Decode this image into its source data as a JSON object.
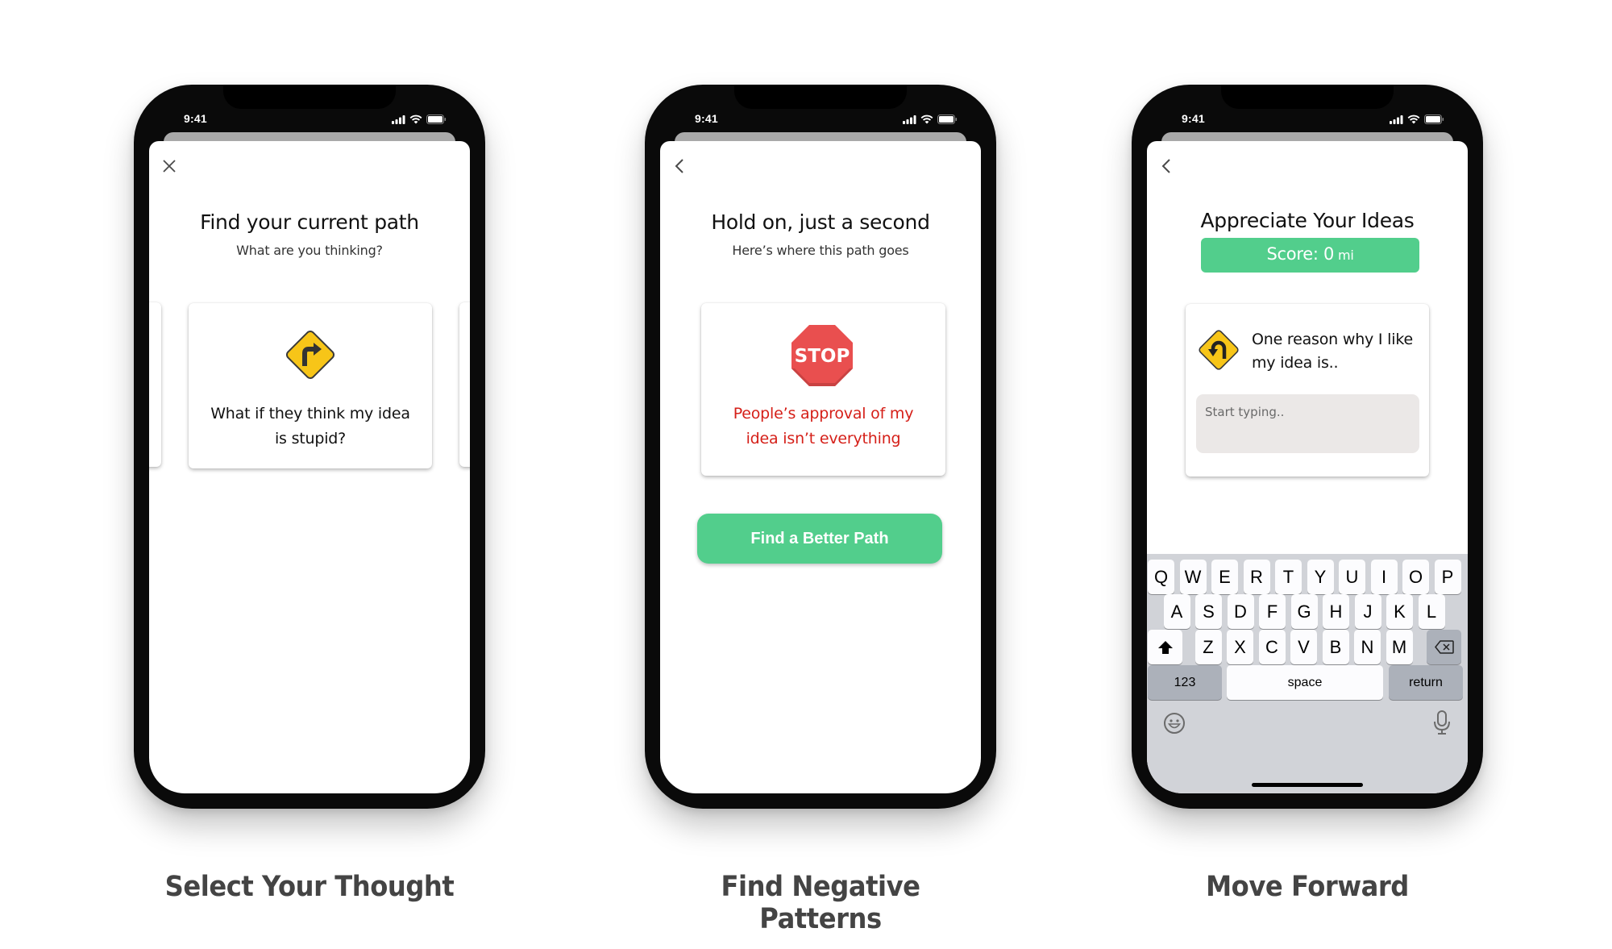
{
  "colors": {
    "accent_green": "#52ce8c",
    "sign_yellow": "#f7c518",
    "stop_red": "#e94f4f",
    "warning_text_red": "#d51f18"
  },
  "phones": [
    {
      "status_time": "9:41",
      "nav_icon": "close-icon",
      "title": "Find your current path",
      "subtitle": "What are you thinking?",
      "card": {
        "icon": "right-turn-sign-icon",
        "text": "What if they think my idea is stupid?"
      },
      "caption": "Select Your Thought"
    },
    {
      "status_time": "9:41",
      "nav_icon": "back-chevron-icon",
      "title": "Hold on, just a second",
      "subtitle": "Here’s where this path goes",
      "card": {
        "icon": "stop-sign-icon",
        "icon_text": "STOP",
        "text": "People’s approval of my idea isn’t everything"
      },
      "button_label": "Find a Better Path",
      "caption": "Find Negative Patterns"
    },
    {
      "status_time": "9:41",
      "nav_icon": "back-chevron-icon",
      "title": "Appreciate Your Ideas",
      "score": {
        "label": "Score: 0",
        "unit": "mi"
      },
      "card": {
        "icon": "u-turn-sign-icon",
        "text": "One reason why I like my idea is..",
        "input_placeholder": "Start typing..",
        "input_value": ""
      },
      "keyboard": {
        "row1": [
          "Q",
          "W",
          "E",
          "R",
          "T",
          "Y",
          "U",
          "I",
          "O",
          "P"
        ],
        "row2": [
          "A",
          "S",
          "D",
          "F",
          "G",
          "H",
          "J",
          "K",
          "L"
        ],
        "row3": [
          "Z",
          "X",
          "C",
          "V",
          "B",
          "N",
          "M"
        ],
        "numbers_label": "123",
        "space_label": "space",
        "return_label": "return"
      },
      "caption": "Move Forward"
    }
  ]
}
